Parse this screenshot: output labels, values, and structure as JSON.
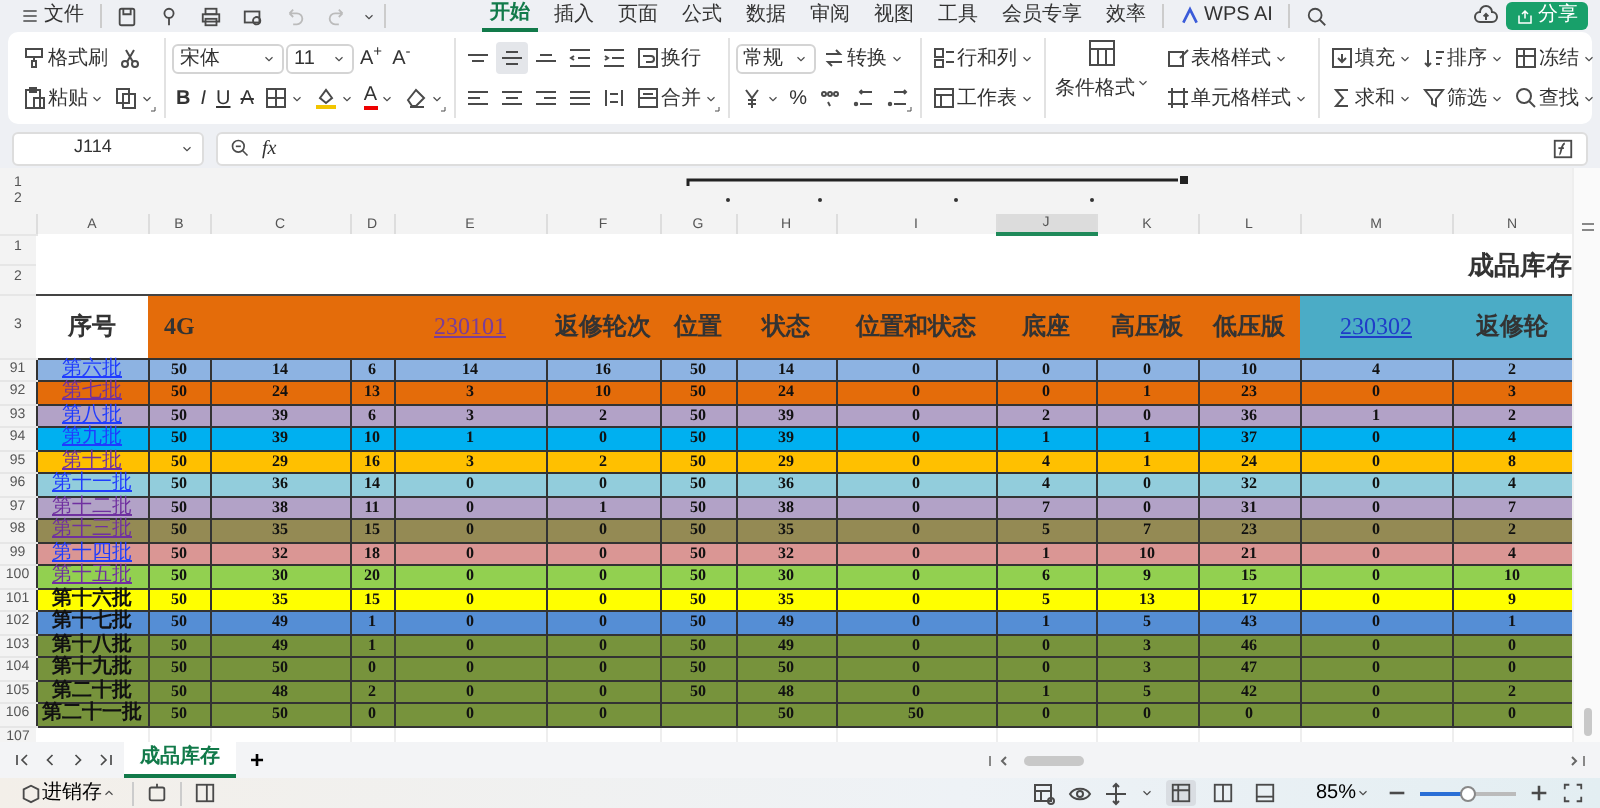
{
  "toolbar": {
    "file_menu": "文件",
    "tabs": [
      {
        "label": "开始",
        "selected": true
      },
      {
        "label": "插入",
        "selected": false
      },
      {
        "label": "页面",
        "selected": false
      },
      {
        "label": "公式",
        "selected": false
      },
      {
        "label": "数据",
        "selected": false
      },
      {
        "label": "审阅",
        "selected": false
      },
      {
        "label": "视图",
        "selected": false
      },
      {
        "label": "工具",
        "selected": false
      },
      {
        "label": "会员专享",
        "selected": false
      },
      {
        "label": "效率",
        "selected": false
      }
    ],
    "ai_label": "WPS AI",
    "share": "分享"
  },
  "ribbon": {
    "clipboard": {
      "format_painter": "格式刷",
      "paste": "粘贴"
    },
    "font": {
      "family": "宋体",
      "size": "11",
      "grow": "A$^{+}$",
      "shrink": "A$^{-}$",
      "bold": "B",
      "italic": "I",
      "underline": "U",
      "strike": "A",
      "color_letter": "A"
    },
    "alignment": {
      "valign": [
        {
          "selected": false
        },
        {
          "selected": true
        },
        {
          "selected": false
        }
      ],
      "wrap": "换行",
      "merge": "合并"
    },
    "number": {
      "format": "常规",
      "convert": "转换",
      "percent": "%"
    },
    "cells": {
      "rows_cols": "行和列",
      "worksheet": "工作表"
    },
    "styles": {
      "conditional": "条件格式",
      "table_style": "表格样式",
      "cell_style": "单元格样式"
    },
    "editing": {
      "fill": "填充",
      "sort": "排序",
      "freeze": "冻结",
      "sum": "求和",
      "filter": "筛选",
      "find": "查找"
    }
  },
  "formula_bar": {
    "cell_ref": "J114",
    "fx": "fx"
  },
  "sheet": {
    "outline_levels": [
      "1",
      "2"
    ],
    "columns": [
      {
        "label": "A",
        "selected": false
      },
      {
        "label": "B",
        "selected": false
      },
      {
        "label": "C",
        "selected": false
      },
      {
        "label": "D",
        "selected": false
      },
      {
        "label": "E",
        "selected": false
      },
      {
        "label": "F",
        "selected": false
      },
      {
        "label": "G",
        "selected": false
      },
      {
        "label": "H",
        "selected": false
      },
      {
        "label": "I",
        "selected": false
      },
      {
        "label": "J",
        "selected": true
      },
      {
        "label": "K",
        "selected": false
      },
      {
        "label": "L",
        "selected": false
      },
      {
        "label": "M",
        "selected": false
      },
      {
        "label": "N",
        "selected": false
      }
    ],
    "title_rows": [
      "1",
      "2"
    ],
    "title": "成品库存",
    "header_row": "3",
    "header": [
      {
        "text": "序号",
        "kind": "plain",
        "color": "#ffffff"
      },
      {
        "text": "4G",
        "kind": "plain",
        "color": "#e46c0a"
      },
      {
        "color": "#e46c0a"
      },
      {
        "color": "#e46c0a"
      },
      {
        "text": "230101",
        "kind": "link",
        "color": "#e46c0a"
      },
      {
        "text": "返修轮次",
        "kind": "plain",
        "color": "#e46c0a"
      },
      {
        "text": "位置",
        "kind": "plain",
        "color": "#e46c0a"
      },
      {
        "text": "状态",
        "kind": "plain",
        "color": "#e46c0a"
      },
      {
        "text": "位置和状态",
        "kind": "plain",
        "color": "#e46c0a"
      },
      {
        "text": "底座",
        "kind": "plain",
        "color": "#e46c0a"
      },
      {
        "text": "高压板",
        "kind": "plain",
        "color": "#e46c0a"
      },
      {
        "text": "低压版",
        "kind": "plain",
        "color": "#e46c0a"
      },
      {
        "text": "230302",
        "kind": "link",
        "color": "#4bacc6"
      },
      {
        "text": "返修轮",
        "kind": "plain",
        "color": "#4bacc6"
      }
    ],
    "rows": [
      {
        "num": "91",
        "link": true,
        "visited": false,
        "color": "#8db3e2",
        "cells": [
          "第六批",
          "50",
          "14",
          "6",
          "14",
          "16",
          "50",
          "14",
          "0",
          "0",
          "0",
          "10",
          "4",
          "2"
        ]
      },
      {
        "num": "92",
        "link": true,
        "visited": true,
        "color": "#e46c0a",
        "cells": [
          "第七批",
          "50",
          "24",
          "13",
          "3",
          "10",
          "50",
          "24",
          "0",
          "0",
          "1",
          "23",
          "0",
          "3"
        ]
      },
      {
        "num": "93",
        "link": true,
        "visited": false,
        "color": "#b2a2c7",
        "cells": [
          "第八批",
          "50",
          "39",
          "6",
          "3",
          "2",
          "50",
          "39",
          "0",
          "2",
          "0",
          "36",
          "1",
          "2"
        ]
      },
      {
        "num": "94",
        "link": true,
        "visited": false,
        "color": "#00b0f0",
        "cells": [
          "第九批",
          "50",
          "39",
          "10",
          "1",
          "0",
          "50",
          "39",
          "0",
          "1",
          "1",
          "37",
          "0",
          "4"
        ]
      },
      {
        "num": "95",
        "link": true,
        "visited": true,
        "color": "#ffc000",
        "cells": [
          "第十批",
          "50",
          "29",
          "16",
          "3",
          "2",
          "50",
          "29",
          "0",
          "4",
          "1",
          "24",
          "0",
          "8"
        ]
      },
      {
        "num": "96",
        "link": true,
        "visited": false,
        "color": "#92cddc",
        "cells": [
          "第十一批",
          "50",
          "36",
          "14",
          "0",
          "0",
          "50",
          "36",
          "0",
          "4",
          "0",
          "32",
          "0",
          "4"
        ]
      },
      {
        "num": "97",
        "link": true,
        "visited": true,
        "color": "#b2a2c7",
        "cells": [
          "第十二批",
          "50",
          "38",
          "11",
          "0",
          "1",
          "50",
          "38",
          "0",
          "7",
          "0",
          "31",
          "0",
          "7"
        ]
      },
      {
        "num": "98",
        "link": true,
        "visited": true,
        "color": "#948a54",
        "cells": [
          "第十三批",
          "50",
          "35",
          "15",
          "0",
          "0",
          "50",
          "35",
          "0",
          "5",
          "7",
          "23",
          "0",
          "2"
        ]
      },
      {
        "num": "99",
        "link": true,
        "visited": false,
        "color": "#da9694",
        "cells": [
          "第十四批",
          "50",
          "32",
          "18",
          "0",
          "0",
          "50",
          "32",
          "0",
          "1",
          "10",
          "21",
          "0",
          "4"
        ]
      },
      {
        "num": "100",
        "link": true,
        "visited": true,
        "color": "#92d050",
        "cells": [
          "第十五批",
          "50",
          "30",
          "20",
          "0",
          "0",
          "50",
          "30",
          "0",
          "6",
          "9",
          "15",
          "0",
          "10"
        ]
      },
      {
        "num": "101",
        "link": false,
        "color": "#ffff00",
        "cells": [
          "第十六批",
          "50",
          "35",
          "15",
          "0",
          "0",
          "50",
          "35",
          "0",
          "5",
          "13",
          "17",
          "0",
          "9"
        ]
      },
      {
        "num": "102",
        "link": false,
        "color": "#558ed5",
        "cells": [
          "第十七批",
          "50",
          "49",
          "1",
          "0",
          "0",
          "50",
          "49",
          "0",
          "1",
          "5",
          "43",
          "0",
          "1"
        ]
      },
      {
        "num": "103",
        "link": false,
        "color": "#77933c",
        "cells": [
          "第十八批",
          "50",
          "49",
          "1",
          "0",
          "0",
          "50",
          "49",
          "0",
          "0",
          "3",
          "46",
          "0",
          "0"
        ]
      },
      {
        "num": "104",
        "link": false,
        "color": "#77933c",
        "cells": [
          "第十九批",
          "50",
          "50",
          "0",
          "0",
          "0",
          "50",
          "50",
          "0",
          "0",
          "3",
          "47",
          "0",
          "0"
        ]
      },
      {
        "num": "105",
        "link": false,
        "color": "#77933c",
        "cells": [
          "第二十批",
          "50",
          "48",
          "2",
          "0",
          "0",
          "50",
          "48",
          "0",
          "1",
          "5",
          "42",
          "0",
          "2"
        ]
      },
      {
        "num": "106",
        "link": false,
        "color": "#77933c",
        "cells": [
          "第二十一批",
          "50",
          "50",
          "0",
          "0",
          "0",
          "",
          "50",
          "50",
          "0",
          "0",
          "0",
          "0",
          "0"
        ]
      }
    ],
    "empty_rows": [
      "107"
    ]
  },
  "sheet_tabs": {
    "tabs": [
      {
        "label": "成品库存",
        "selected": true
      }
    ],
    "add": "+"
  },
  "status_bar": {
    "workbook_mode": "进销存",
    "views": [
      {
        "selected": true
      },
      {
        "selected": false
      },
      {
        "selected": false
      }
    ],
    "zoom": "85%",
    "zoom_slider": {
      "level": 0.5
    }
  }
}
